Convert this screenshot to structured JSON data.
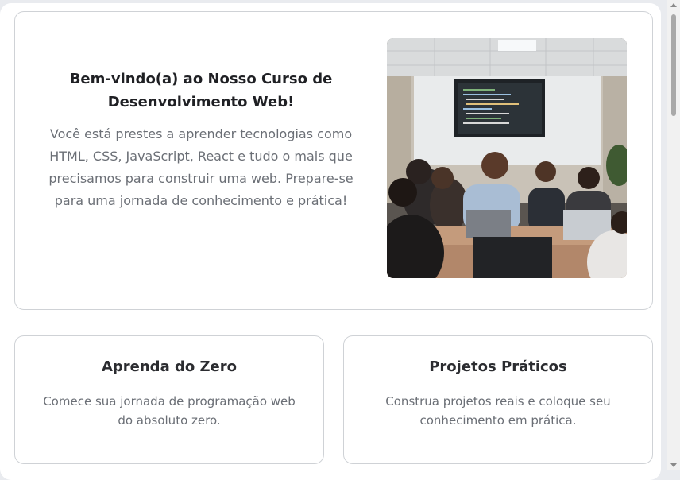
{
  "hero": {
    "title": "Bem-vindo(a) ao Nosso Curso de Desenvolvimento Web!",
    "description": "Você está prestes a aprender tecnologias como HTML, CSS, JavaScript, React e tudo o mais que precisamos para construir uma web. Prepare-se para uma jornada de conhecimento e prática!",
    "image_icon": "classroom-photo"
  },
  "features": [
    {
      "title": "Aprenda do Zero",
      "description": "Comece sua jornada de programação web do absoluto zero."
    },
    {
      "title": "Projetos Práticos",
      "description": "Construa projetos reais e coloque seu conhecimento em prática."
    }
  ],
  "colors": {
    "page_background": "#ffffff",
    "card_border": "#cfd2d6",
    "title_text": "#1f2024",
    "body_text": "#6b6f76"
  }
}
